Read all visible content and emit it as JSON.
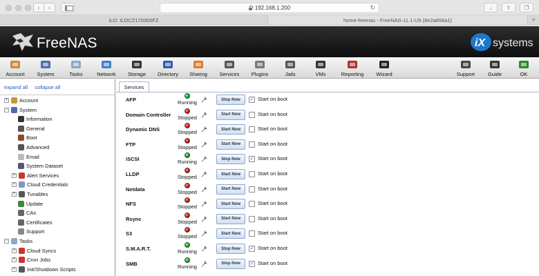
{
  "browser": {
    "url": "192.168.1.200",
    "tabs": [
      "iLO: ILOCZ170300FZ",
      "home-freenas - FreeNAS-11.1-U5 (8e2a858a1)"
    ],
    "new_tab_glyph": "+"
  },
  "brand": {
    "name": "FreeNAS",
    "partner": "iXsystems"
  },
  "toolbar": [
    {
      "label": "Account",
      "icon": "account-icon"
    },
    {
      "label": "System",
      "icon": "system-icon"
    },
    {
      "label": "Tasks",
      "icon": "tasks-icon"
    },
    {
      "label": "Network",
      "icon": "network-icon"
    },
    {
      "label": "Storage",
      "icon": "storage-icon"
    },
    {
      "label": "Directory",
      "icon": "directory-icon"
    },
    {
      "label": "Sharing",
      "icon": "sharing-icon"
    },
    {
      "label": "Services",
      "icon": "services-icon"
    },
    {
      "label": "Plugins",
      "icon": "plugins-icon"
    },
    {
      "label": "Jails",
      "icon": "jails-icon"
    },
    {
      "label": "VMs",
      "icon": "vms-icon"
    },
    {
      "label": "Reporting",
      "icon": "reporting-icon"
    },
    {
      "label": "Wizard",
      "icon": "wizard-icon"
    },
    {
      "label": "Support",
      "icon": "support-icon"
    },
    {
      "label": "Guide",
      "icon": "guide-icon"
    },
    {
      "label": "OK",
      "icon": "ok-icon"
    }
  ],
  "tree": {
    "expand_all": "expand all",
    "collapse_all": "collapse all",
    "nodes": [
      {
        "label": "Account",
        "exp": "+"
      },
      {
        "label": "System",
        "exp": "−"
      },
      {
        "label": "Information",
        "exp": ""
      },
      {
        "label": "General",
        "exp": ""
      },
      {
        "label": "Boot",
        "exp": ""
      },
      {
        "label": "Advanced",
        "exp": ""
      },
      {
        "label": "Email",
        "exp": ""
      },
      {
        "label": "System Dataset",
        "exp": ""
      },
      {
        "label": "Alert Services",
        "exp": "+"
      },
      {
        "label": "Cloud Credentials",
        "exp": "+"
      },
      {
        "label": "Tunables",
        "exp": "+"
      },
      {
        "label": "Update",
        "exp": ""
      },
      {
        "label": "CAs",
        "exp": ""
      },
      {
        "label": "Certificates",
        "exp": ""
      },
      {
        "label": "Support",
        "exp": ""
      },
      {
        "label": "Tasks",
        "exp": "−"
      },
      {
        "label": "Cloud Syncs",
        "exp": "+"
      },
      {
        "label": "Cron Jobs",
        "exp": "+"
      },
      {
        "label": "Init/Shutdown Scripts",
        "exp": "+"
      }
    ]
  },
  "services_tab": "Services",
  "start_on_boot_label": "Start on boot",
  "services": [
    {
      "name": "AFP",
      "status": "Running",
      "action": "Stop Now",
      "boot": true
    },
    {
      "name": "Domain Controller",
      "status": "Stopped",
      "action": "Start Now",
      "boot": false
    },
    {
      "name": "Dynamic DNS",
      "status": "Stopped",
      "action": "Start Now",
      "boot": false
    },
    {
      "name": "FTP",
      "status": "Stopped",
      "action": "Start Now",
      "boot": false
    },
    {
      "name": "iSCSI",
      "status": "Running",
      "action": "Stop Now",
      "boot": true
    },
    {
      "name": "LLDP",
      "status": "Stopped",
      "action": "Start Now",
      "boot": false
    },
    {
      "name": "Netdata",
      "status": "Stopped",
      "action": "Start Now",
      "boot": false
    },
    {
      "name": "NFS",
      "status": "Stopped",
      "action": "Start Now",
      "boot": false
    },
    {
      "name": "Rsync",
      "status": "Stopped",
      "action": "Start Now",
      "boot": false
    },
    {
      "name": "S3",
      "status": "Stopped",
      "action": "Start Now",
      "boot": false
    },
    {
      "name": "S.M.A.R.T.",
      "status": "Running",
      "action": "Stop Now",
      "boot": true
    },
    {
      "name": "SMB",
      "status": "Running",
      "action": "Stop Now",
      "boot": true
    }
  ],
  "colors": {
    "running": "#00aa00",
    "stopped": "#dd0000",
    "link": "#1d5fb8"
  }
}
